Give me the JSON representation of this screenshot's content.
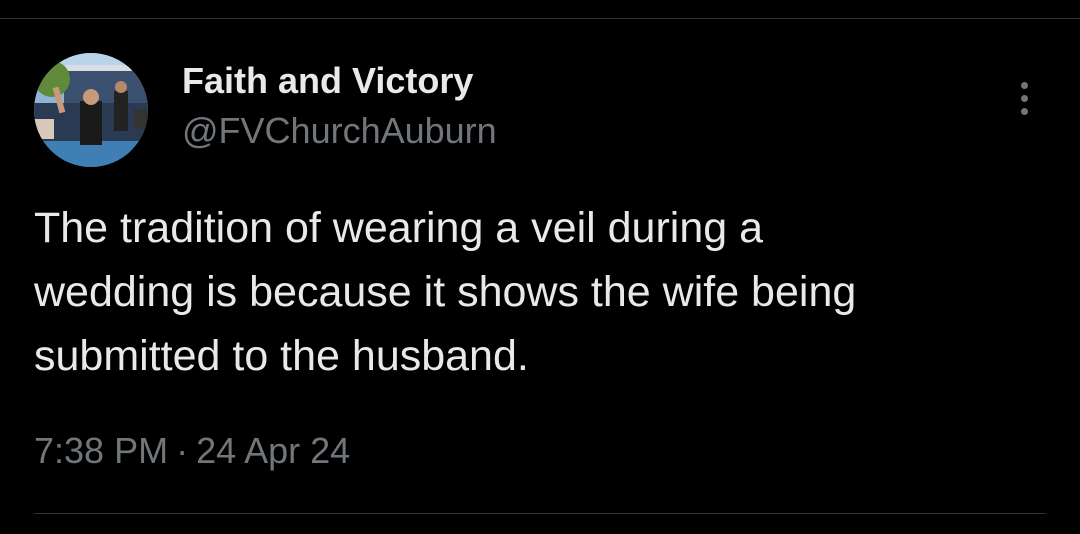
{
  "tweet": {
    "author": {
      "display_name": "Faith and Victory",
      "handle": "@FVChurchAuburn",
      "avatar_icon": "profile-photo"
    },
    "more_icon": "more-vertical-icon",
    "text_lines": [
      "The tradition of wearing a veil during a",
      "wedding is because it shows the wife being",
      "submitted to the husband."
    ],
    "time": "7:38 PM",
    "separator": "·",
    "date": "24 Apr 24"
  },
  "colors": {
    "background": "#000000",
    "primary_text": "#e7e9ea",
    "secondary_text": "#71767b",
    "divider": "#2f3336"
  }
}
